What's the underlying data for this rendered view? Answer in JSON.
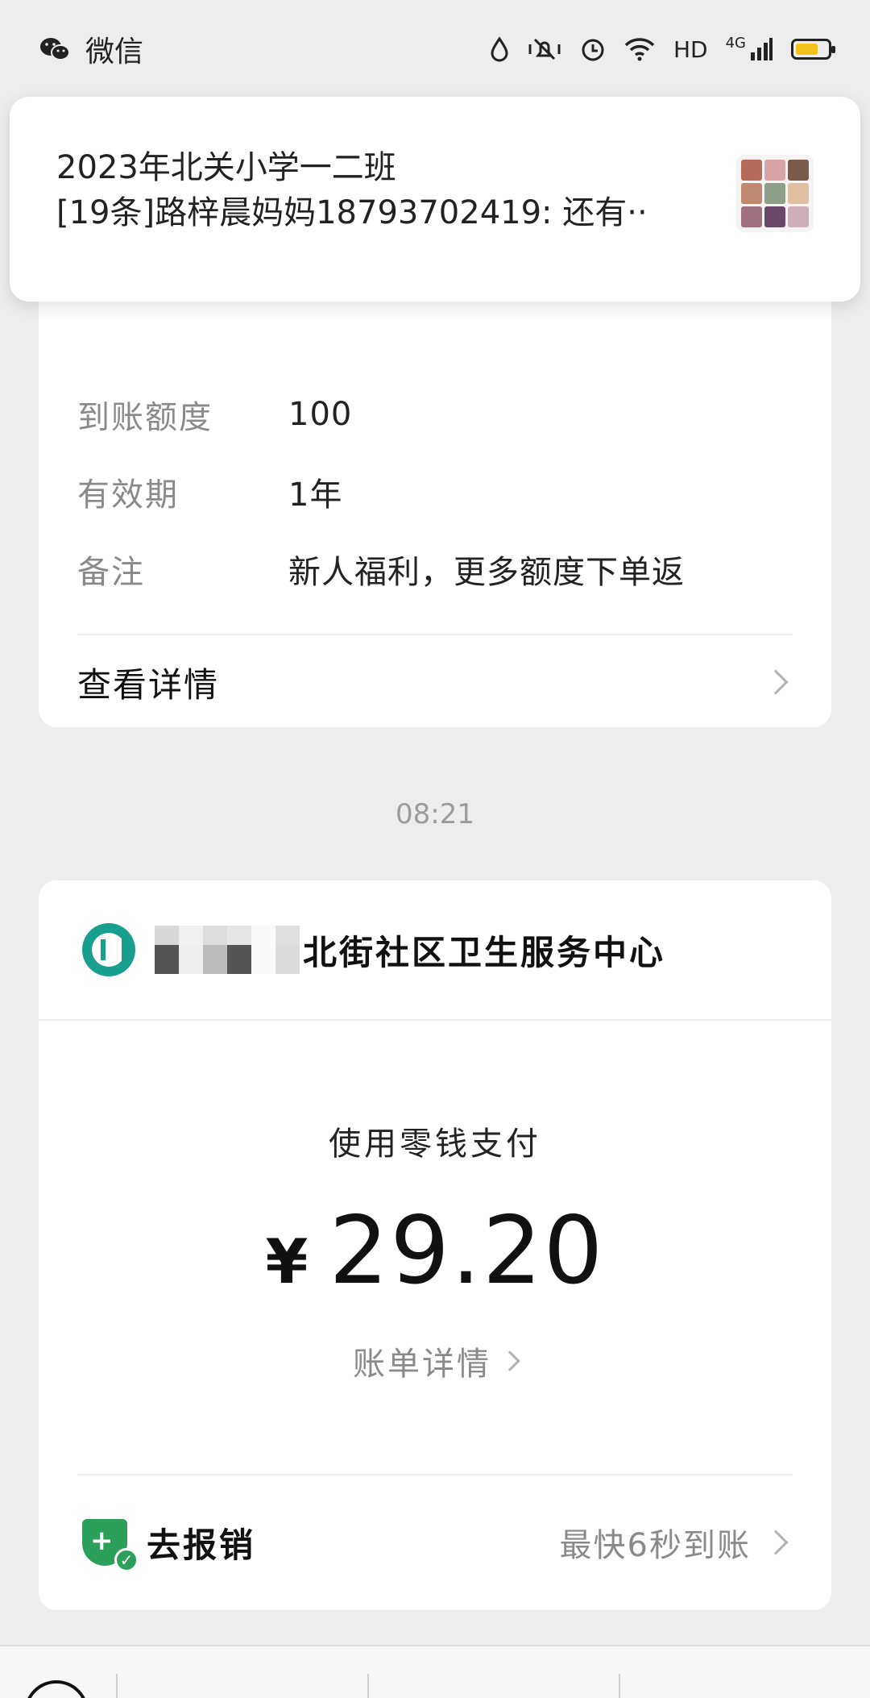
{
  "status_bar": {
    "app_name": "微信",
    "network_hd": "HD",
    "network_4g": "4G"
  },
  "notification": {
    "group_name": "2023年北关小学一二班",
    "message": "[19条]路梓晨妈妈18793702419: 还有··"
  },
  "coupon_card": {
    "rows": [
      {
        "label": "到账额度",
        "value": "100"
      },
      {
        "label": "有效期",
        "value": "1年"
      },
      {
        "label": "备注",
        "value": "新人福利，更多额度下单返"
      }
    ],
    "details_link": "查看详情"
  },
  "timestamp": "08:21",
  "payment_card": {
    "merchant_name": "北街社区卫生服务中心",
    "pay_method": "使用零钱支付",
    "currency": "¥",
    "amount": "29.20",
    "bill_details": "账单详情",
    "reimburse_label": "去报销",
    "reimburse_hint": "最快6秒到账"
  },
  "colors": {
    "bank_green": "#199f8e",
    "shield_green": "#2ca05a",
    "battery_yellow": "#f3c21b"
  }
}
